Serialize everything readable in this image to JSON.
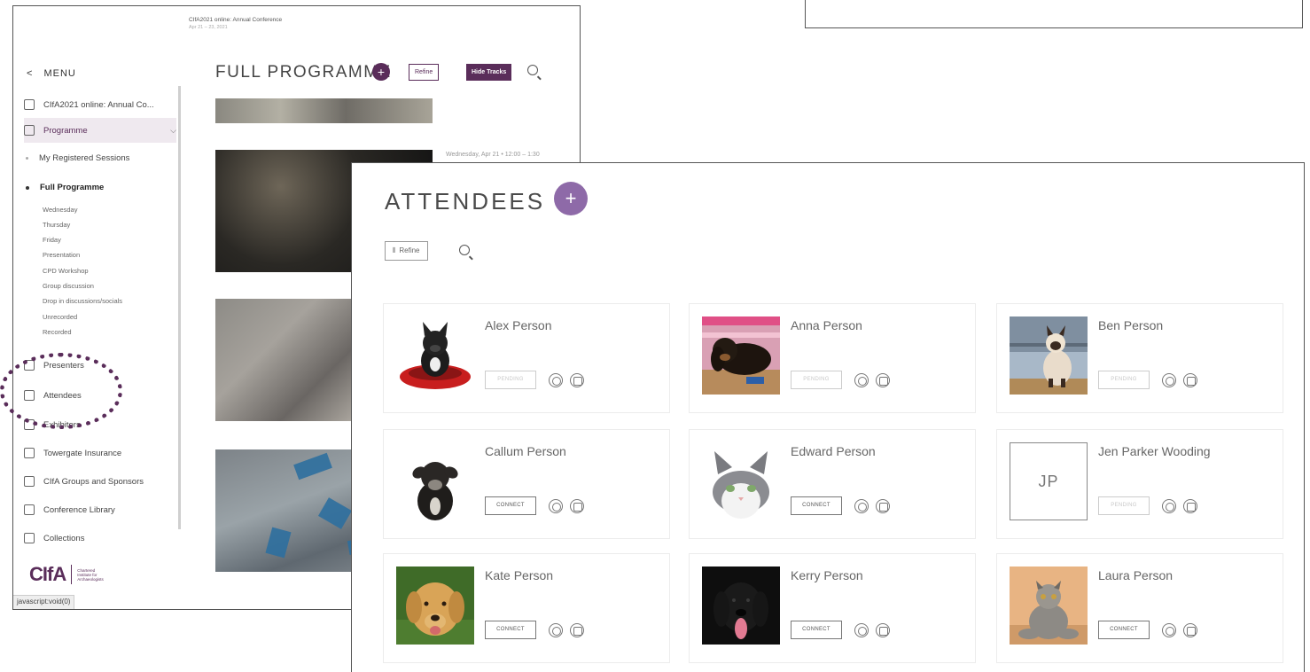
{
  "back_window": {
    "menu_label": "MENU",
    "sidebar": {
      "top_item": "CIfA2021 online: Annual Co...",
      "programme": "Programme",
      "my_sessions": "My Registered Sessions",
      "full_programme": "Full Programme",
      "days": [
        "Wednesday",
        "Thursday",
        "Friday",
        "Presentation",
        "CPD Workshop",
        "Group discussion",
        "Drop in discussions/socials",
        "Unrecorded",
        "Recorded"
      ],
      "presenters": "Presenters",
      "attendees": "Attendees",
      "exhibitors": "Exhibitors",
      "towergate": "Towergate Insurance",
      "groups": "CIfA Groups and Sponsors",
      "library": "Conference Library",
      "collections": "Collections"
    },
    "logo": {
      "mark": "CIfA",
      "text": "Chartered Institute for Archaeologists"
    },
    "status_bar": "javascript:void(0)",
    "crumb_title": "CIfA2021 online: Annual Conference",
    "crumb_sub": "Apr 21 – 23, 2021",
    "page_title": "FULL PROGRAMME",
    "refine_label": "Refine",
    "hide_tracks_label": "Hide Tracks",
    "session_time": "Wednesday, Apr 21 • 12:00 – 1:30"
  },
  "front_window": {
    "title": "ATTENDEES",
    "refine_label": "Refine",
    "attendees": [
      {
        "name": "Alex Person",
        "action": "PENDING"
      },
      {
        "name": "Anna Person",
        "action": "PENDING"
      },
      {
        "name": "Ben Person",
        "action": "PENDING"
      },
      {
        "name": "Callum Person",
        "action": "CONNECT"
      },
      {
        "name": "Edward Person",
        "action": "CONNECT"
      },
      {
        "name": "Jen Parker Wooding",
        "action": "PENDING",
        "initials": "JP"
      },
      {
        "name": "Kate Person",
        "action": "CONNECT"
      },
      {
        "name": "Kerry Person",
        "action": "CONNECT"
      },
      {
        "name": "Laura Person",
        "action": "CONNECT"
      }
    ]
  },
  "colors": {
    "brand": "#5a2d5a",
    "plus_accent": "#8e6aa8"
  },
  "icons": [
    "home-icon",
    "calendar-icon",
    "presenter-icon",
    "attendees-icon",
    "exhibitor-icon",
    "shield-icon",
    "groups-icon",
    "library-icon",
    "collections-icon",
    "search-icon",
    "chat-icon",
    "video-icon"
  ]
}
